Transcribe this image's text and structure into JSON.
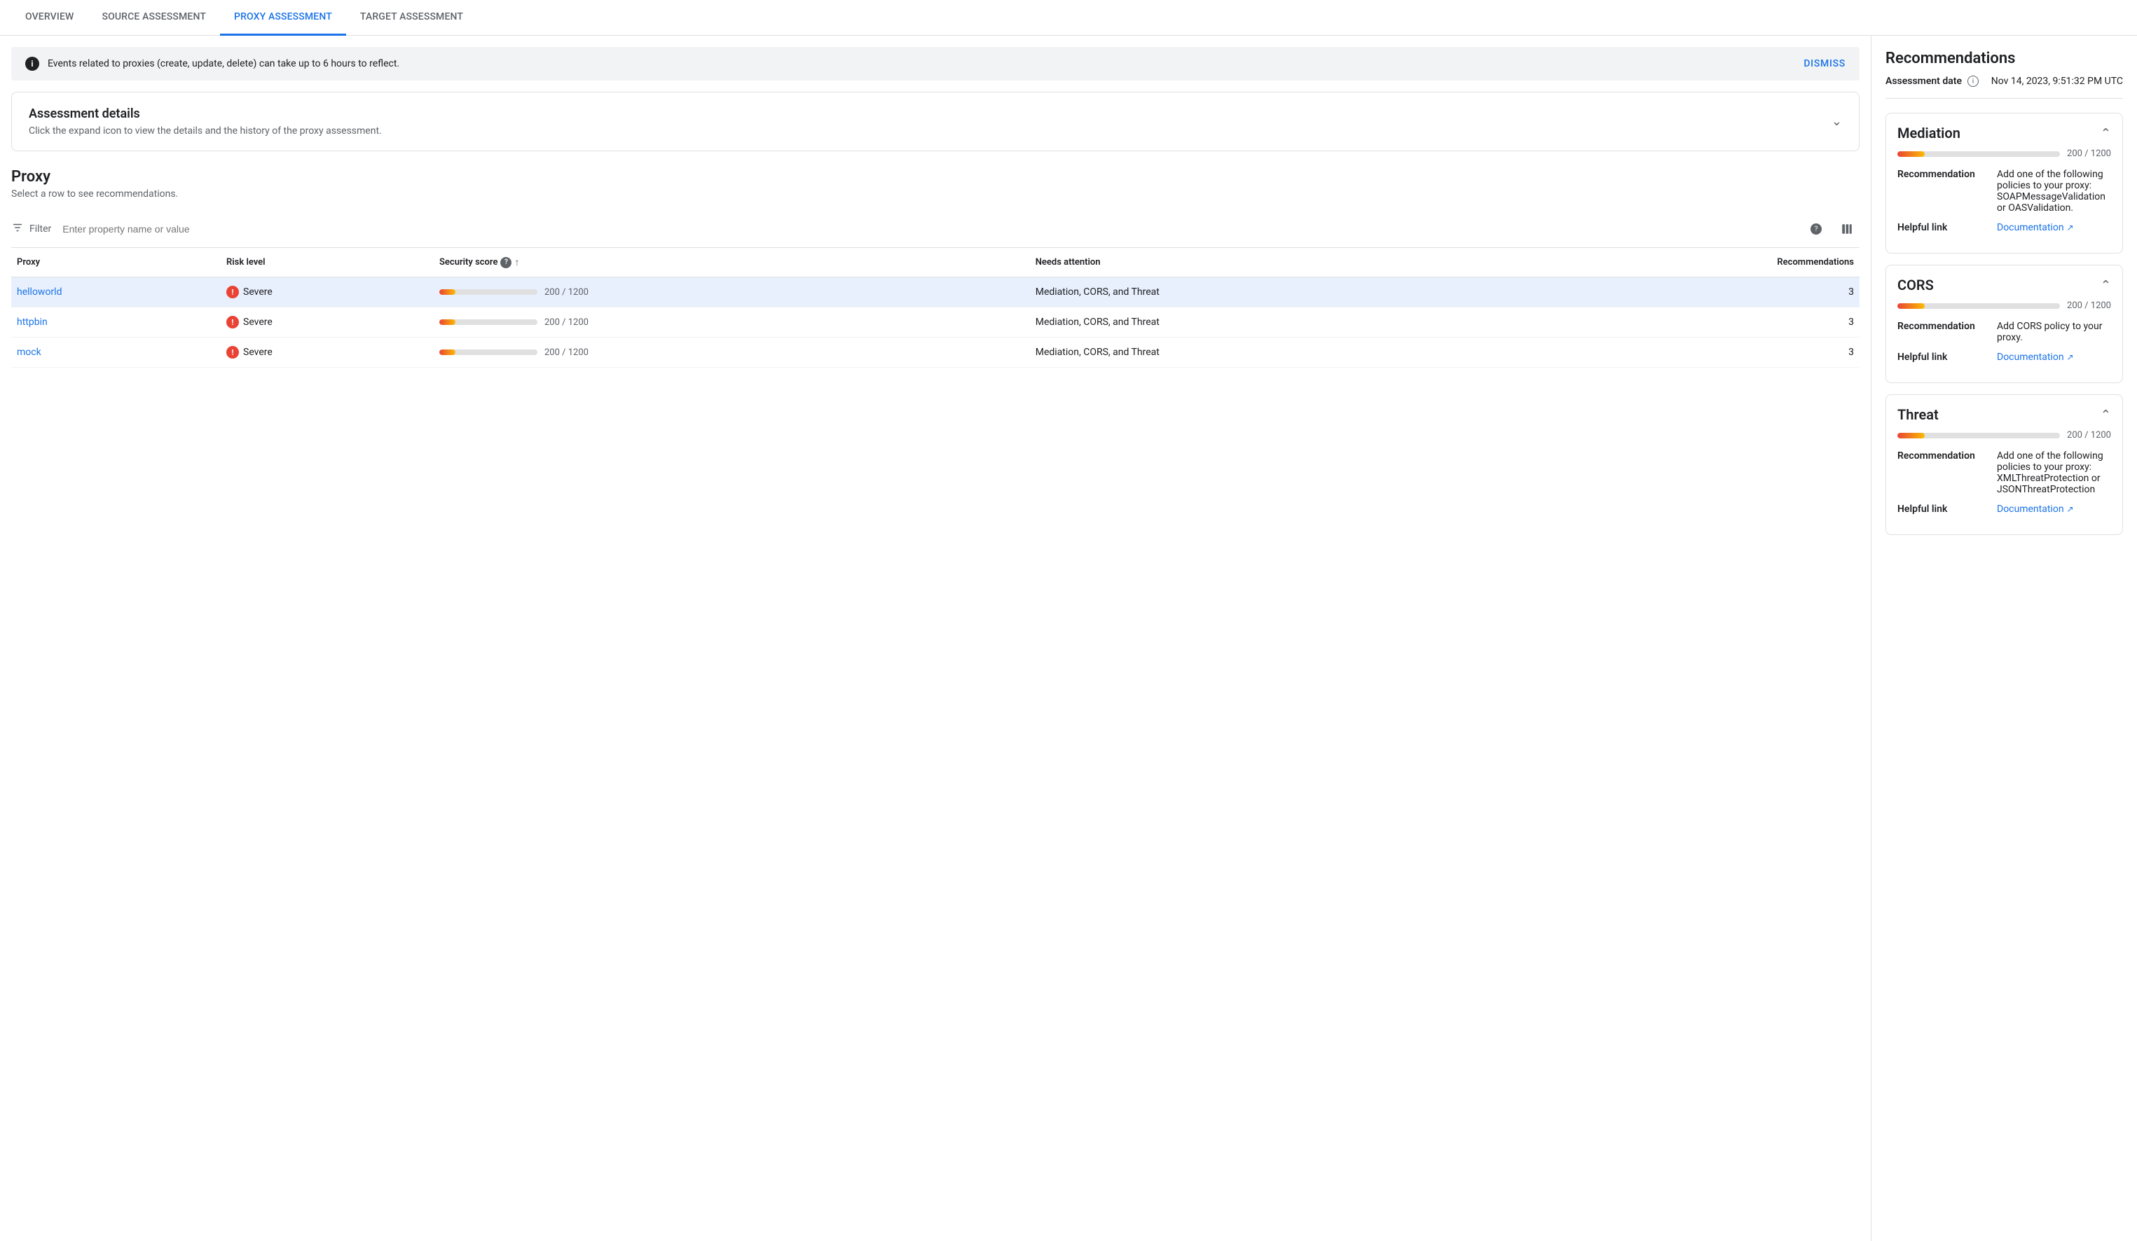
{
  "tabs": [
    {
      "id": "overview",
      "label": "OVERVIEW",
      "active": false
    },
    {
      "id": "source-assessment",
      "label": "SOURCE ASSESSMENT",
      "active": false
    },
    {
      "id": "proxy-assessment",
      "label": "PROXY ASSESSMENT",
      "active": true
    },
    {
      "id": "target-assessment",
      "label": "TARGET ASSESSMENT",
      "active": false
    }
  ],
  "banner": {
    "text": "Events related to proxies (create, update, delete) can take up to 6 hours to reflect.",
    "dismiss_label": "DISMISS"
  },
  "assessment_details": {
    "title": "Assessment details",
    "subtitle": "Click the expand icon to view the details and the history of the proxy assessment."
  },
  "proxy_section": {
    "title": "Proxy",
    "subtitle": "Select a row to see recommendations.",
    "filter_placeholder": "Enter property name or value"
  },
  "table": {
    "headers": [
      {
        "id": "proxy",
        "label": "Proxy",
        "has_help": false,
        "has_sort": false
      },
      {
        "id": "risk_level",
        "label": "Risk level",
        "has_help": false,
        "has_sort": false
      },
      {
        "id": "security_score",
        "label": "Security score",
        "has_help": true,
        "has_sort": true
      },
      {
        "id": "needs_attention",
        "label": "Needs attention",
        "has_help": false,
        "has_sort": false
      },
      {
        "id": "recommendations",
        "label": "Recommendations",
        "has_help": false,
        "has_sort": false
      }
    ],
    "rows": [
      {
        "proxy": "helloworld",
        "risk_level": "Severe",
        "score_value": "200 / 1200",
        "score_pct": 16.7,
        "needs_attention": "Mediation, CORS, and Threat",
        "recommendations": 3,
        "selected": true
      },
      {
        "proxy": "httpbin",
        "risk_level": "Severe",
        "score_value": "200 / 1200",
        "score_pct": 16.7,
        "needs_attention": "Mediation, CORS, and Threat",
        "recommendations": 3,
        "selected": false
      },
      {
        "proxy": "mock",
        "risk_level": "Severe",
        "score_value": "200 / 1200",
        "score_pct": 16.7,
        "needs_attention": "Mediation, CORS, and Threat",
        "recommendations": 3,
        "selected": false
      }
    ]
  },
  "right_panel": {
    "title": "Recommendations",
    "assessment_date_label": "Assessment date",
    "assessment_date_value": "Nov 14, 2023, 9:51:32 PM UTC",
    "categories": [
      {
        "id": "mediation",
        "title": "Mediation",
        "score": "200 / 1200",
        "score_pct": 16.7,
        "recommendation_label": "Recommendation",
        "recommendation_text": "Add one of the following policies to your proxy: SOAPMessageValidation or OASValidation.",
        "helpful_link_label": "Helpful link",
        "helpful_link_text": "Documentation",
        "collapsed": false
      },
      {
        "id": "cors",
        "title": "CORS",
        "score": "200 / 1200",
        "score_pct": 16.7,
        "recommendation_label": "Recommendation",
        "recommendation_text": "Add CORS policy to your proxy.",
        "helpful_link_label": "Helpful link",
        "helpful_link_text": "Documentation",
        "collapsed": false
      },
      {
        "id": "threat",
        "title": "Threat",
        "score": "200 / 1200",
        "score_pct": 16.7,
        "recommendation_label": "Recommendation",
        "recommendation_text": "Add one of the following policies to your proxy: XMLThreatProtection or JSONThreatProtection",
        "helpful_link_label": "Helpful link",
        "helpful_link_text": "Documentation",
        "collapsed": false
      }
    ]
  }
}
